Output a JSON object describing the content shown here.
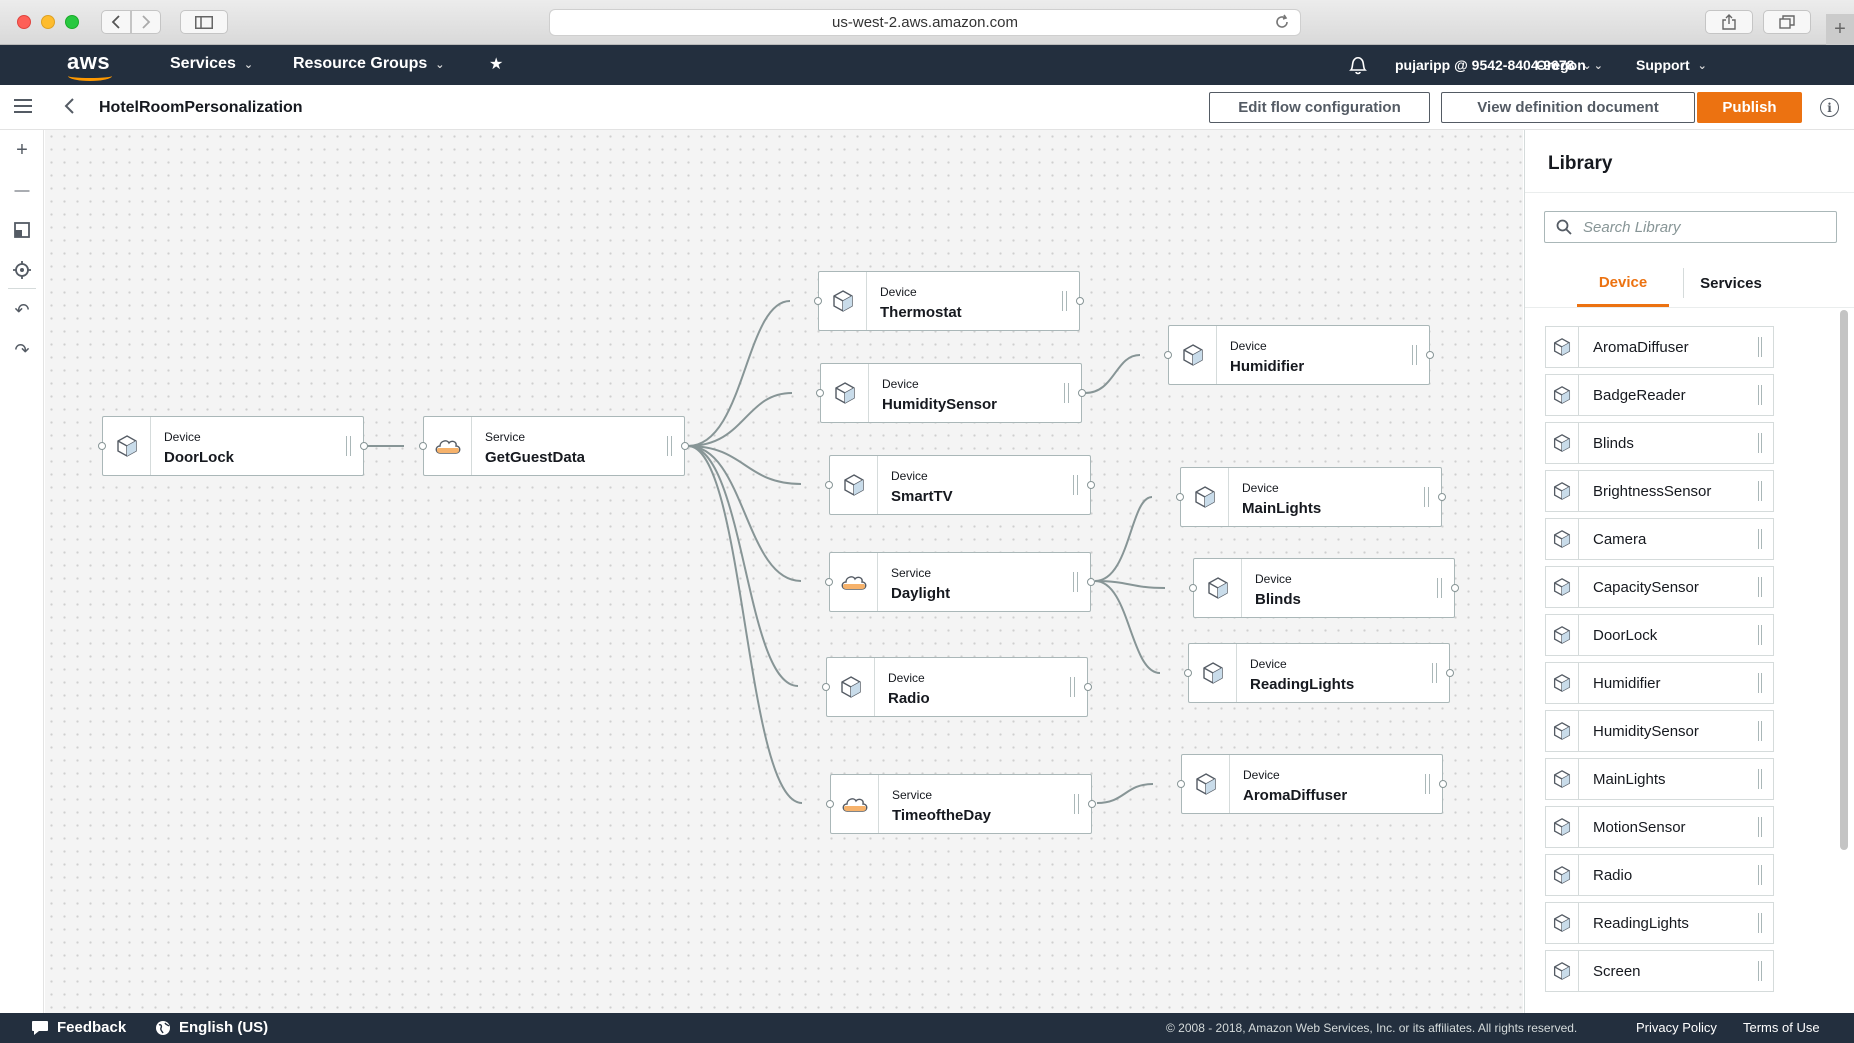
{
  "browser": {
    "url": "us-west-2.aws.amazon.com"
  },
  "aws_nav": {
    "logo_text": "aws",
    "services_label": "Services",
    "resource_groups_label": "Resource Groups",
    "pin_glyph": "★",
    "user_label": "pujaripp @ 9542-8404-9678",
    "region_label": "Oregon",
    "support_label": "Support",
    "caret_glyph": "⌄"
  },
  "toolbar": {
    "title": "HotelRoomPersonalization",
    "edit_label": "Edit flow configuration",
    "view_label": "View definition document",
    "publish_label": "Publish",
    "info_glyph": "i",
    "accent_color": "#ec7211"
  },
  "left_tools": {
    "zoom_in_glyph": "+",
    "zoom_out_glyph": "—",
    "undo_glyph": "↶",
    "redo_glyph": "↷"
  },
  "nodes": [
    {
      "type": "Device",
      "name": "DoorLock",
      "icon": "cube-icon"
    },
    {
      "type": "Service",
      "name": "GetGuestData",
      "icon": "cloud-icon"
    },
    {
      "type": "Device",
      "name": "Thermostat",
      "icon": "cube-icon"
    },
    {
      "type": "Device",
      "name": "HumiditySensor",
      "icon": "cube-icon"
    },
    {
      "type": "Device",
      "name": "SmartTV",
      "icon": "cube-icon"
    },
    {
      "type": "Service",
      "name": "Daylight",
      "icon": "cloud-icon"
    },
    {
      "type": "Device",
      "name": "Radio",
      "icon": "cube-icon"
    },
    {
      "type": "Service",
      "name": "TimeoftheDay",
      "icon": "cloud-icon"
    },
    {
      "type": "Device",
      "name": "Humidifier",
      "icon": "cube-icon"
    },
    {
      "type": "Device",
      "name": "MainLights",
      "icon": "cube-icon"
    },
    {
      "type": "Device",
      "name": "Blinds",
      "icon": "cube-icon"
    },
    {
      "type": "Device",
      "name": "ReadingLights",
      "icon": "cube-icon"
    },
    {
      "type": "Device",
      "name": "AromaDiffuser",
      "icon": "cube-icon"
    }
  ],
  "library": {
    "title": "Library",
    "search_placeholder": "Search Library",
    "tab_device": "Device",
    "tab_services": "Services",
    "active_tab": "Device",
    "items": [
      "AromaDiffuser",
      "BadgeReader",
      "Blinds",
      "BrightnessSensor",
      "Camera",
      "CapacitySensor",
      "DoorLock",
      "Humidifier",
      "HumiditySensor",
      "MainLights",
      "MotionSensor",
      "Radio",
      "ReadingLights",
      "Screen"
    ]
  },
  "footer": {
    "feedback_label": "Feedback",
    "language_label": "English (US)",
    "copyright": "© 2008 - 2018, Amazon Web Services, Inc. or its affiliates. All rights reserved.",
    "privacy_label": "Privacy Policy",
    "terms_label": "Terms of Use"
  }
}
